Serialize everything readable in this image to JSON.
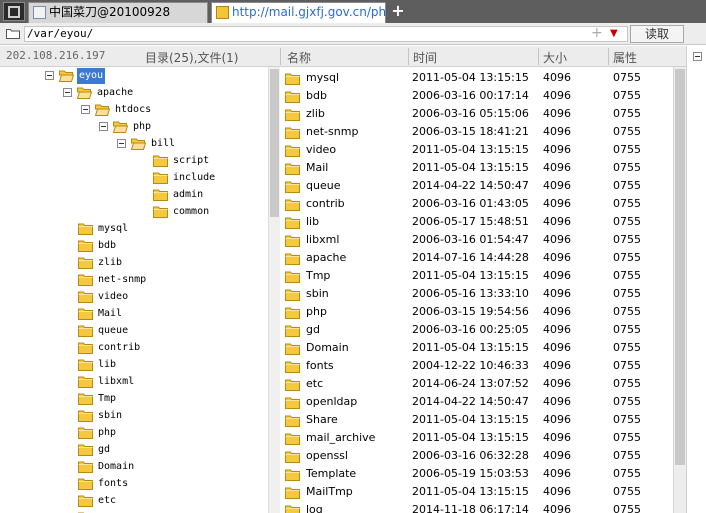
{
  "tabs": [
    {
      "label": "中国菜刀@20100928",
      "active": false
    },
    {
      "label": "http://mail.gjxfj.gov.cn/php/bi...",
      "active": true
    }
  ],
  "tab_add_label": "+",
  "address": {
    "path": "/var/eyou/",
    "add_icon": "+",
    "dropdown_icon": "chevron-down-icon",
    "read_label": "读取"
  },
  "header": {
    "ip": "202.108.216.197",
    "stats": "目录(25),文件(1)",
    "col_name": "名称",
    "col_time": "时间",
    "col_size": "大小",
    "col_attr": "属性"
  },
  "tree": [
    {
      "label": "eyou",
      "depth": 0,
      "expanded": true,
      "selected": true
    },
    {
      "label": "apache",
      "depth": 1,
      "expanded": true
    },
    {
      "label": "htdocs",
      "depth": 2,
      "expanded": true
    },
    {
      "label": "php",
      "depth": 3,
      "expanded": true
    },
    {
      "label": "bill",
      "depth": 4,
      "expanded": true
    },
    {
      "label": "script",
      "depth": 5
    },
    {
      "label": "include",
      "depth": 5
    },
    {
      "label": "admin",
      "depth": 5
    },
    {
      "label": "common",
      "depth": 5
    },
    {
      "label": "mysql",
      "depth": 1
    },
    {
      "label": "bdb",
      "depth": 1
    },
    {
      "label": "zlib",
      "depth": 1
    },
    {
      "label": "net-snmp",
      "depth": 1
    },
    {
      "label": "video",
      "depth": 1
    },
    {
      "label": "Mail",
      "depth": 1
    },
    {
      "label": "queue",
      "depth": 1
    },
    {
      "label": "contrib",
      "depth": 1
    },
    {
      "label": "lib",
      "depth": 1
    },
    {
      "label": "libxml",
      "depth": 1
    },
    {
      "label": "Tmp",
      "depth": 1
    },
    {
      "label": "sbin",
      "depth": 1
    },
    {
      "label": "php",
      "depth": 1
    },
    {
      "label": "gd",
      "depth": 1
    },
    {
      "label": "Domain",
      "depth": 1
    },
    {
      "label": "fonts",
      "depth": 1
    },
    {
      "label": "etc",
      "depth": 1
    },
    {
      "label": "",
      "depth": 1
    }
  ],
  "files": [
    {
      "name": "mysql",
      "time": "2011-05-04 13:15:15",
      "size": "4096",
      "attr": "0755"
    },
    {
      "name": "bdb",
      "time": "2006-03-16 00:17:14",
      "size": "4096",
      "attr": "0755"
    },
    {
      "name": "zlib",
      "time": "2006-03-16 05:15:06",
      "size": "4096",
      "attr": "0755"
    },
    {
      "name": "net-snmp",
      "time": "2006-03-15 18:41:21",
      "size": "4096",
      "attr": "0755"
    },
    {
      "name": "video",
      "time": "2011-05-04 13:15:15",
      "size": "4096",
      "attr": "0755"
    },
    {
      "name": "Mail",
      "time": "2011-05-04 13:15:15",
      "size": "4096",
      "attr": "0755"
    },
    {
      "name": "queue",
      "time": "2014-04-22 14:50:47",
      "size": "4096",
      "attr": "0755"
    },
    {
      "name": "contrib",
      "time": "2006-03-16 01:43:05",
      "size": "4096",
      "attr": "0755"
    },
    {
      "name": "lib",
      "time": "2006-05-17 15:48:51",
      "size": "4096",
      "attr": "0755"
    },
    {
      "name": "libxml",
      "time": "2006-03-16 01:54:47",
      "size": "4096",
      "attr": "0755"
    },
    {
      "name": "apache",
      "time": "2014-07-16 14:44:28",
      "size": "4096",
      "attr": "0755"
    },
    {
      "name": "Tmp",
      "time": "2011-05-04 13:15:15",
      "size": "4096",
      "attr": "0755"
    },
    {
      "name": "sbin",
      "time": "2006-05-16 13:33:10",
      "size": "4096",
      "attr": "0755"
    },
    {
      "name": "php",
      "time": "2006-03-15 19:54:56",
      "size": "4096",
      "attr": "0755"
    },
    {
      "name": "gd",
      "time": "2006-03-16 00:25:05",
      "size": "4096",
      "attr": "0755"
    },
    {
      "name": "Domain",
      "time": "2011-05-04 13:15:15",
      "size": "4096",
      "attr": "0755"
    },
    {
      "name": "fonts",
      "time": "2004-12-22 10:46:33",
      "size": "4096",
      "attr": "0755"
    },
    {
      "name": "etc",
      "time": "2014-06-24 13:07:52",
      "size": "4096",
      "attr": "0755"
    },
    {
      "name": "openldap",
      "time": "2014-04-22 14:50:47",
      "size": "4096",
      "attr": "0755"
    },
    {
      "name": "Share",
      "time": "2011-05-04 13:15:15",
      "size": "4096",
      "attr": "0755"
    },
    {
      "name": "mail_archive",
      "time": "2011-05-04 13:15:15",
      "size": "4096",
      "attr": "0755"
    },
    {
      "name": "openssl",
      "time": "2006-03-16 06:32:28",
      "size": "4096",
      "attr": "0755"
    },
    {
      "name": "Template",
      "time": "2006-05-19 15:03:53",
      "size": "4096",
      "attr": "0755"
    },
    {
      "name": "MailTmp",
      "time": "2011-05-04 13:15:15",
      "size": "4096",
      "attr": "0755"
    },
    {
      "name": "log",
      "time": "2014-11-18 06:17:14",
      "size": "4096",
      "attr": "0755"
    }
  ],
  "colors": {
    "tabbar_bg": "#5e5e5e",
    "selection": "#3a7ad1",
    "folder_fill": "#f5c93d",
    "folder_stroke": "#b88a14",
    "url_text": "#2a6bd4"
  }
}
